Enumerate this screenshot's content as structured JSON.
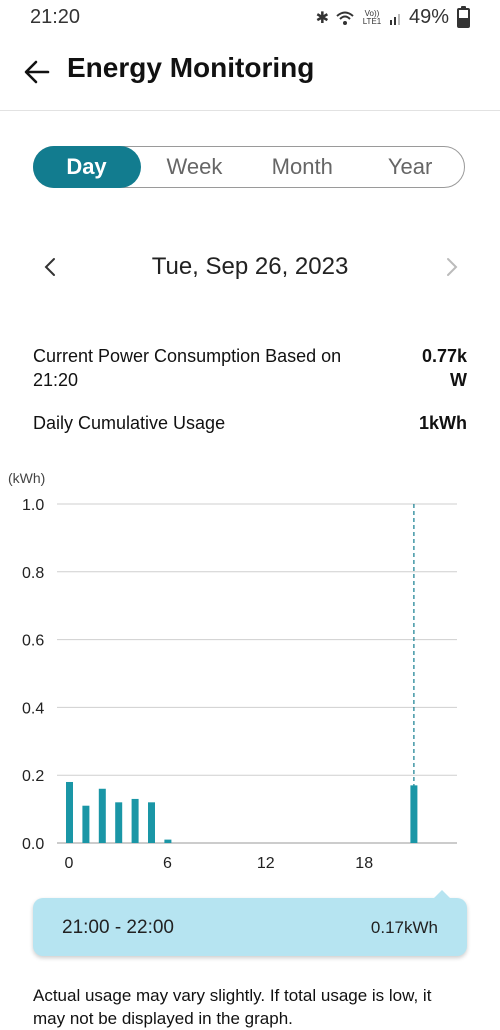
{
  "status_bar": {
    "time": "21:20",
    "battery": "49%",
    "network": "Vo)) LTE1"
  },
  "header": {
    "title": "Energy Monitoring"
  },
  "period_tabs": [
    {
      "label": "Day",
      "active": true
    },
    {
      "label": "Week",
      "active": false
    },
    {
      "label": "Month",
      "active": false
    },
    {
      "label": "Year",
      "active": false
    }
  ],
  "date_nav": {
    "date": "Tue, Sep 26, 2023"
  },
  "metrics": {
    "current_label": "Current Power Consumption Based on 21:20",
    "current_value": "0.77k W",
    "daily_label": "Daily Cumulative Usage",
    "daily_value": "1kWh"
  },
  "chart_data": {
    "type": "bar",
    "unit_label": "(kWh)",
    "ylim": [
      0,
      1.0
    ],
    "y_ticks": [
      "1.0",
      "0.8",
      "0.6",
      "0.4",
      "0.2",
      "0.0"
    ],
    "x_ticks": [
      "0",
      "6",
      "12",
      "18"
    ],
    "hours": [
      0,
      1,
      2,
      3,
      4,
      5,
      6,
      21
    ],
    "values": [
      0.18,
      0.11,
      0.16,
      0.12,
      0.13,
      0.12,
      0.01,
      0.17
    ],
    "selected_hour": 21,
    "bar_color": "#1a96a6",
    "grid": true
  },
  "tooltip": {
    "time_range": "21:00 - 22:00",
    "value": "0.17kWh"
  },
  "footnote": "Actual usage may vary slightly. If total usage is low, it may not be displayed in the graph."
}
